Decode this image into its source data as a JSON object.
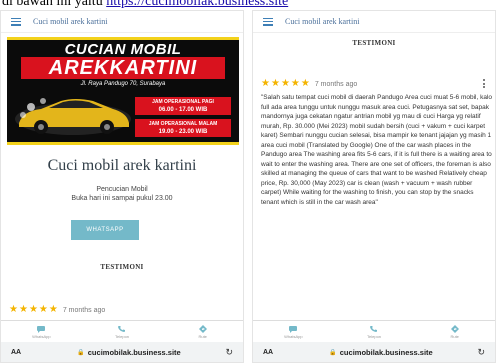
{
  "caption": {
    "text": "di bawah ini yaitu",
    "link": "https://cucimobilak.business.site"
  },
  "left": {
    "app_title": "Cuci mobil arek kartini",
    "banner": {
      "line1": "CUCIAN MOBIL",
      "line2": "AREKKARTINI",
      "address": "Jl. Raya Pandugo 70, Surabaya",
      "hours_morning_label": "JAM OPERASIONAL PAGI",
      "hours_morning": "06.00 - 17.00 WIB",
      "hours_evening_label": "JAM OPERASIONAL MALAM",
      "hours_evening": "19.00 - 23.00 WIB"
    },
    "shop_title": "Cuci mobil arek kartini",
    "category": "Pencucian Mobil",
    "open_status": "Buka hari ini sampai pukul 23.00",
    "whatsapp_label": "WHATSAPP",
    "testimoni_label": "TESTIMONI",
    "review_age": "7 months ago"
  },
  "right": {
    "app_title": "Cuci mobil arek kartini",
    "testimoni_label": "TESTIMONI",
    "review_age": "7 months ago",
    "review_text": "\"Salah satu tempat cuci mobil di daerah Pandugo Area cuci muat 5-6 mobil, kalo full ada area tunggu untuk nunggu masuk area cuci. Petugasnya sat set, bapak mandornya juga cekatan ngatur antrian mobil yg mau di cuci Harga yg relatif murah, Rp. 30.000 (Mei 2023) mobil sudah bersih (cuci + vakum + cuci karpet karet) Sembari nunggu cucian selesai, bisa mampir ke tenant jajajan yg masih 1 area cuci mobil (Translated by Google) One of the car wash places in the Pandugo area The washing area fits 5-6 cars, if it is full there is a waiting area to wait to enter the washing area. There are one set of officers, the foreman is also skilled at managing the queue of cars that want to be washed Relatively cheap price, Rp. 30,000 (May 2023) car is clean (wash + vacuum + wash rubber carpet) While waiting for the washing to finish, you can stop by the snacks tenant which is still in the car wash area\""
  },
  "rating_stars": 5,
  "navbar": {
    "items": [
      {
        "label": "WhatsApp",
        "icon": "chat-icon"
      },
      {
        "label": "Telepon",
        "icon": "phone-icon"
      },
      {
        "label": "Rute",
        "icon": "directions-icon"
      }
    ]
  },
  "browser": {
    "aa_label": "AA",
    "url": "cucimobilak.business.site",
    "reload_glyph": "↻",
    "lock_glyph": "🔒"
  },
  "colors": {
    "accent": "#74b9c9",
    "star": "#f4b400",
    "banner_red": "#d9121e",
    "banner_yellow": "#f3d21b"
  }
}
